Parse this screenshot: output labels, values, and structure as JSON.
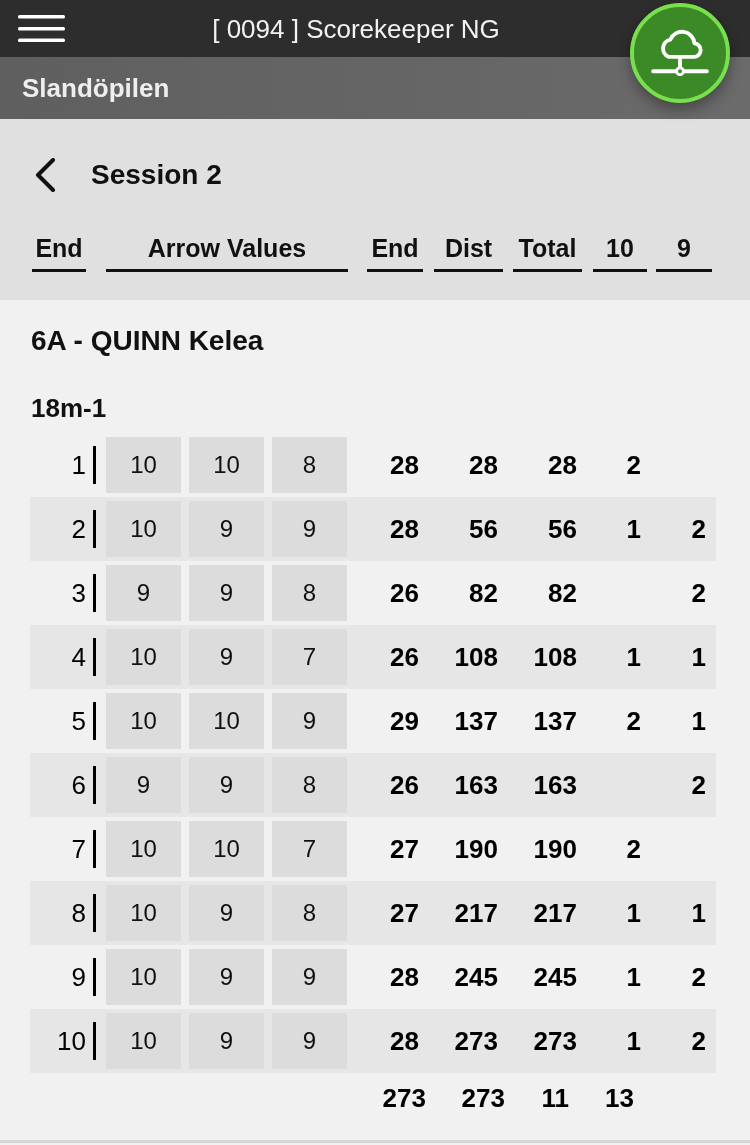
{
  "app_bar": {
    "title": "[ 0094 ] Scorekeeper NG"
  },
  "sub_bar": {
    "title": "Slandöpilen"
  },
  "session": {
    "title": "Session 2"
  },
  "columns": [
    "End",
    "Arrow Values",
    "End",
    "Dist",
    "Total",
    "10",
    "9"
  ],
  "archer": "6A - QUINN Kelea",
  "distance": "18m-1",
  "rows": [
    {
      "end": "1",
      "arrows": [
        "10",
        "10",
        "8"
      ],
      "end_total": "28",
      "dist": "28",
      "total": "28",
      "tens": "2"
    },
    {
      "end": "2",
      "arrows": [
        "10",
        "9",
        "9"
      ],
      "end_total": "28",
      "dist": "56",
      "total": "56",
      "tens": "1",
      "nines": "2"
    },
    {
      "end": "3",
      "arrows": [
        "9",
        "9",
        "8"
      ],
      "end_total": "26",
      "dist": "82",
      "total": "82",
      "nines": "2"
    },
    {
      "end": "4",
      "arrows": [
        "10",
        "9",
        "7"
      ],
      "end_total": "26",
      "dist": "108",
      "total": "108",
      "tens": "1",
      "nines": "1"
    },
    {
      "end": "5",
      "arrows": [
        "10",
        "10",
        "9"
      ],
      "end_total": "29",
      "dist": "137",
      "total": "137",
      "tens": "2",
      "nines": "1"
    },
    {
      "end": "6",
      "arrows": [
        "9",
        "9",
        "8"
      ],
      "end_total": "26",
      "dist": "163",
      "total": "163",
      "nines": "2"
    },
    {
      "end": "7",
      "arrows": [
        "10",
        "10",
        "7"
      ],
      "end_total": "27",
      "dist": "190",
      "total": "190",
      "tens": "2"
    },
    {
      "end": "8",
      "arrows": [
        "10",
        "9",
        "8"
      ],
      "end_total": "27",
      "dist": "217",
      "total": "217",
      "tens": "1",
      "nines": "1"
    },
    {
      "end": "9",
      "arrows": [
        "10",
        "9",
        "9"
      ],
      "end_total": "28",
      "dist": "245",
      "total": "245",
      "tens": "1",
      "nines": "2"
    },
    {
      "end": "10",
      "arrows": [
        "10",
        "9",
        "9"
      ],
      "end_total": "28",
      "dist": "273",
      "total": "273",
      "tens": "1",
      "nines": "2"
    }
  ],
  "totals": {
    "dist": "273",
    "total": "273",
    "tens": "11",
    "nines": "13"
  }
}
